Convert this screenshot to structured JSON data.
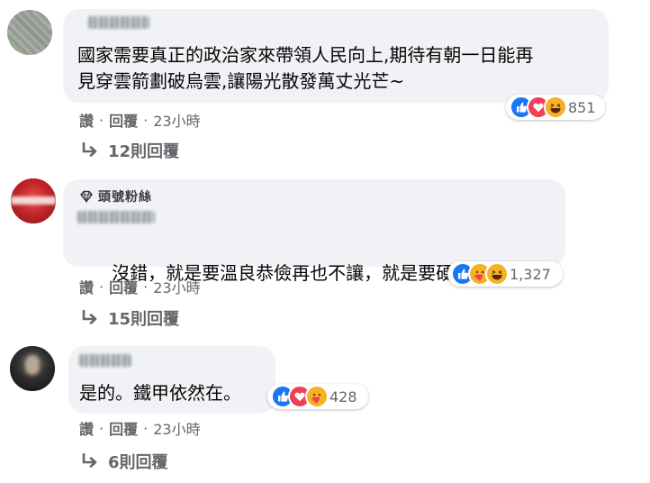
{
  "reactions": {
    "like_color": "#1877f2",
    "love_color": "#f33e58",
    "haha_color": "#f7b125",
    "angry_color": "#e9710f"
  },
  "comments": [
    {
      "text_lines": [
        "國家需要真正的政治家來帶領人民向上,期待有朝一日能再",
        "見穿雲箭劃破烏雲,讓陽光散發萬丈光芒~"
      ],
      "reaction_icons": [
        "like-icon",
        "love-icon",
        "haha-icon"
      ],
      "reaction_count": "851",
      "actions": {
        "like": "讚",
        "reply": "回覆",
        "time": "23小時"
      },
      "replies_label": "12則回覆"
    },
    {
      "badge": "頭號粉絲",
      "badge_icon": "top-fan-diamond-icon",
      "text": "沒錯，就是要溫良恭儉再也不讓，就是要硬起來。",
      "inline_emoji": "angry-emoji-icon",
      "reaction_icons": [
        "like-icon",
        "care-icon",
        "haha-icon"
      ],
      "reaction_count": "1,327",
      "actions": {
        "like": "讚",
        "reply": "回覆",
        "time": "23小時"
      },
      "replies_label": "15則回覆"
    },
    {
      "text": "是的。鐵甲依然在。",
      "reaction_icons": [
        "like-icon",
        "love-icon",
        "care-icon"
      ],
      "reaction_count": "428",
      "actions": {
        "like": "讚",
        "reply": "回覆",
        "time": "23小時"
      },
      "replies_label": "6則回覆"
    }
  ]
}
